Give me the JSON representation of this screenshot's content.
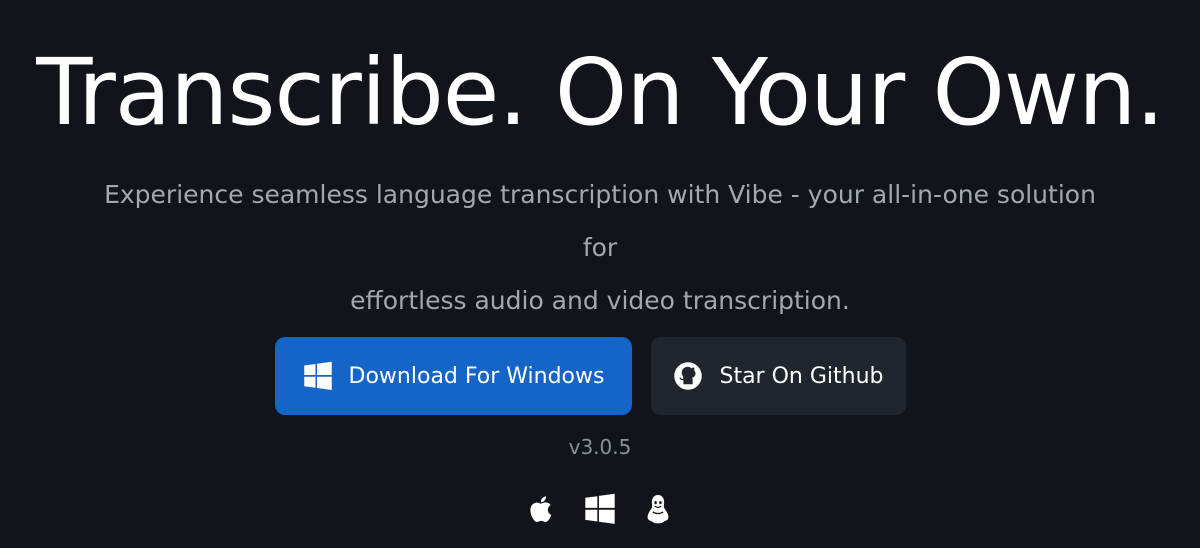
{
  "hero": {
    "title": "Transcribe. On Your Own.",
    "subtitle_line1": "Experience seamless language transcription with Vibe - your all-in-one solution for",
    "subtitle_line2": "effortless audio and video transcription."
  },
  "actions": {
    "download_label": "Download For Windows",
    "github_label": "Star On Github"
  },
  "version": "v3.0.5",
  "platforms": [
    "apple-icon",
    "windows-icon",
    "linux-icon"
  ],
  "colors": {
    "background": "#12141b",
    "primary": "#1565c8",
    "secondary": "#21252d",
    "muted_text": "#a4a7b0"
  }
}
